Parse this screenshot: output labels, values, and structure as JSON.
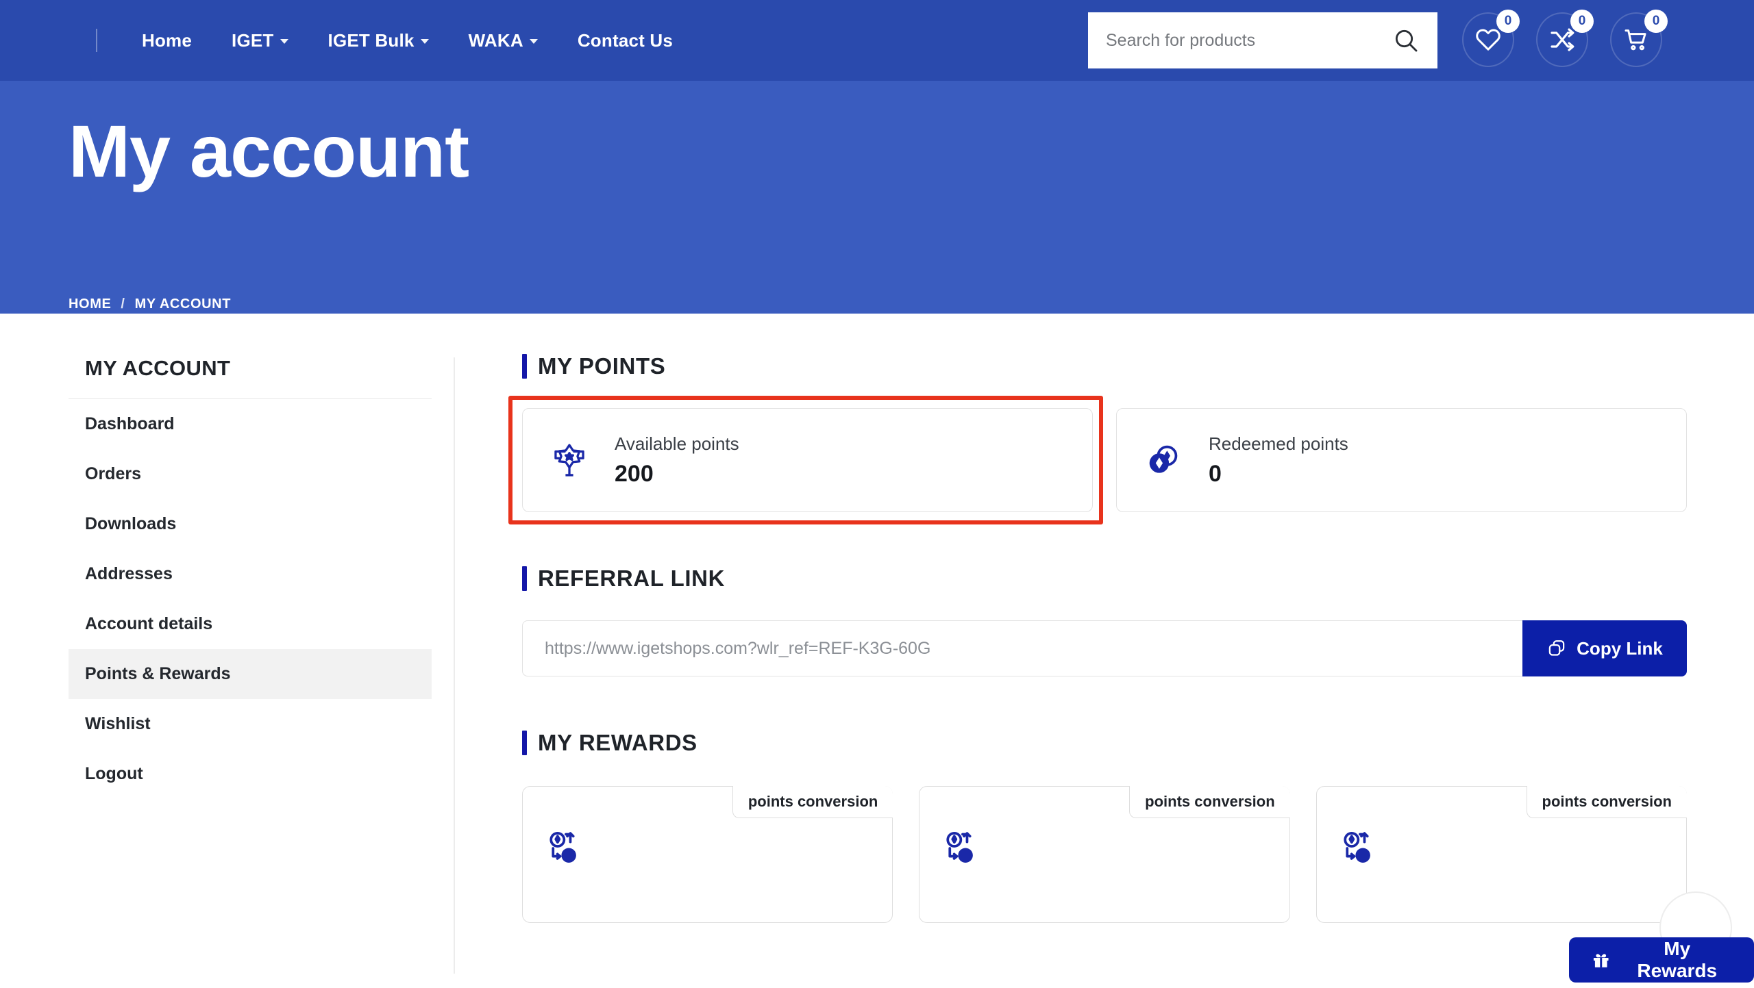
{
  "header": {
    "nav": [
      {
        "label": "Home",
        "has_dropdown": false
      },
      {
        "label": "IGET",
        "has_dropdown": true
      },
      {
        "label": "IGET Bulk",
        "has_dropdown": true
      },
      {
        "label": "WAKA",
        "has_dropdown": true
      },
      {
        "label": "Contact Us",
        "has_dropdown": false
      }
    ],
    "search": {
      "placeholder": "Search for products",
      "value": ""
    },
    "icons": [
      {
        "name": "wishlist-icon",
        "count": "0"
      },
      {
        "name": "compare-icon",
        "count": "0"
      },
      {
        "name": "cart-icon",
        "count": "0"
      }
    ]
  },
  "hero": {
    "title": "My account",
    "breadcrumb": {
      "home": "HOME",
      "separator": "/",
      "current": "MY ACCOUNT"
    }
  },
  "sidebar": {
    "title": "MY ACCOUNT",
    "items": [
      {
        "label": "Dashboard",
        "active": false
      },
      {
        "label": "Orders",
        "active": false
      },
      {
        "label": "Downloads",
        "active": false
      },
      {
        "label": "Addresses",
        "active": false
      },
      {
        "label": "Account details",
        "active": false
      },
      {
        "label": "Points & Rewards",
        "active": true
      },
      {
        "label": "Wishlist",
        "active": false
      },
      {
        "label": "Logout",
        "active": false
      }
    ]
  },
  "main": {
    "points": {
      "heading": "MY POINTS",
      "cards": [
        {
          "label": "Available points",
          "value": "200",
          "icon": "award-badge-icon",
          "highlighted": true
        },
        {
          "label": "Redeemed points",
          "value": "0",
          "icon": "coins-icon",
          "highlighted": false
        }
      ]
    },
    "referral": {
      "heading": "REFERRAL LINK",
      "link_value": "https://www.igetshops.com?wlr_ref=REF-K3G-60G",
      "copy_label": "Copy Link"
    },
    "rewards": {
      "heading": "MY REWARDS",
      "cards": [
        {
          "tab_label": "points conversion",
          "icon": "points-conversion-icon"
        },
        {
          "tab_label": "points conversion",
          "icon": "points-conversion-icon"
        },
        {
          "tab_label": "points conversion",
          "icon": "points-conversion-icon"
        }
      ]
    }
  },
  "floating": {
    "my_rewards_label": "My Rewards"
  },
  "colors": {
    "header_blue": "#2a4aad",
    "hero_blue": "#3a5cbf",
    "accent_blue": "#1417a8",
    "button_blue": "#0c1fa8",
    "highlight_red": "#e8331c"
  }
}
